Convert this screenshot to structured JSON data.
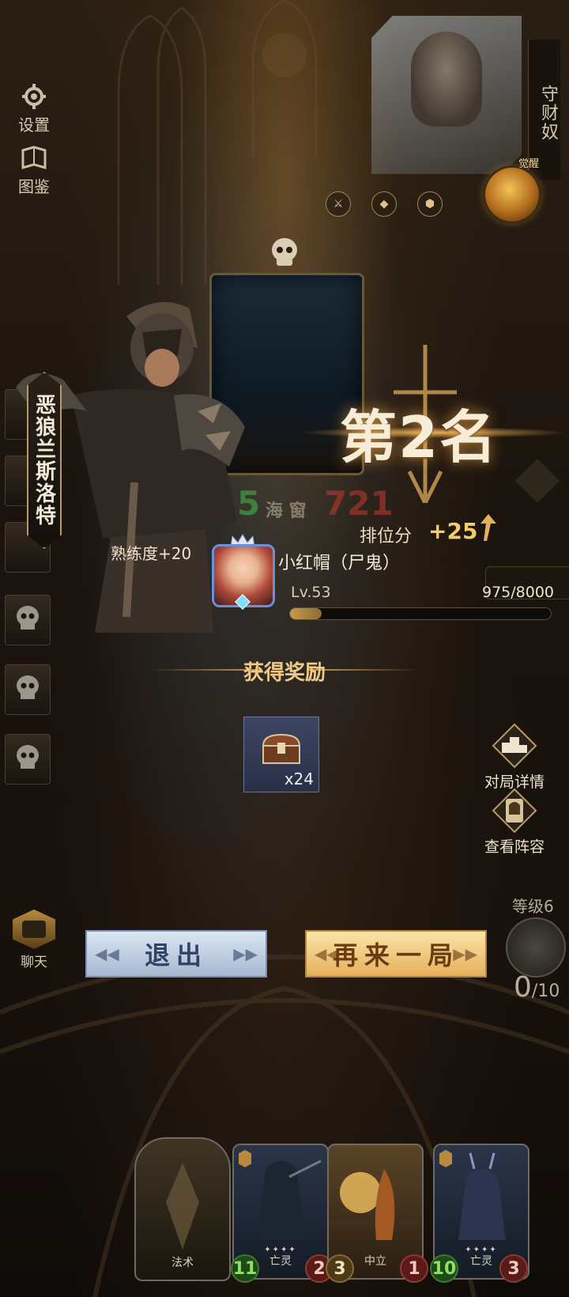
{
  "side_menu": [
    {
      "label": "设置",
      "icon": "gear-icon"
    },
    {
      "label": "图鉴",
      "icon": "book-icon"
    }
  ],
  "opponent": {
    "guard_label": "守财奴",
    "awaken_label": "觉醒"
  },
  "hero": {
    "name": "恶狼兰斯洛特",
    "faded_left": "5",
    "faded_mid": "海 窗",
    "faded_right": "721"
  },
  "result": {
    "rank_text": "第2名",
    "rank_points_label": "排位分",
    "rank_points_delta": "+25"
  },
  "player": {
    "proficiency": "熟练度+20",
    "name": "小红帽（尸鬼）",
    "level": "Lv.53",
    "xp": "975/8000",
    "xp_fraction": 0.122
  },
  "rewards": {
    "title": "获得奖励",
    "items": [
      {
        "icon": "treasure-chest-icon",
        "count": "x24"
      }
    ]
  },
  "right_buttons": [
    {
      "label": "对局详情",
      "icon": "podium-icon"
    },
    {
      "label": "查看阵容",
      "icon": "helmet-card-icon"
    }
  ],
  "buttons": {
    "exit": "退出",
    "again": "再来一局"
  },
  "chat": {
    "label": "聊天"
  },
  "level_panel": {
    "label": "等级6",
    "count": "0",
    "max": "/10"
  },
  "hand_cards": [
    {
      "type": "法术",
      "kind": "spell"
    },
    {
      "type": "亡灵",
      "attack": "11",
      "health": "2"
    },
    {
      "type": "中立",
      "attack": "3",
      "health": "1"
    },
    {
      "type": "亡灵",
      "attack": "10",
      "health": "3"
    }
  ],
  "colors": {
    "gold_text": "#f3cd66",
    "reward_title": "#efc986",
    "exit_button": "#a8b8cf",
    "again_button": "#e4b15c"
  }
}
